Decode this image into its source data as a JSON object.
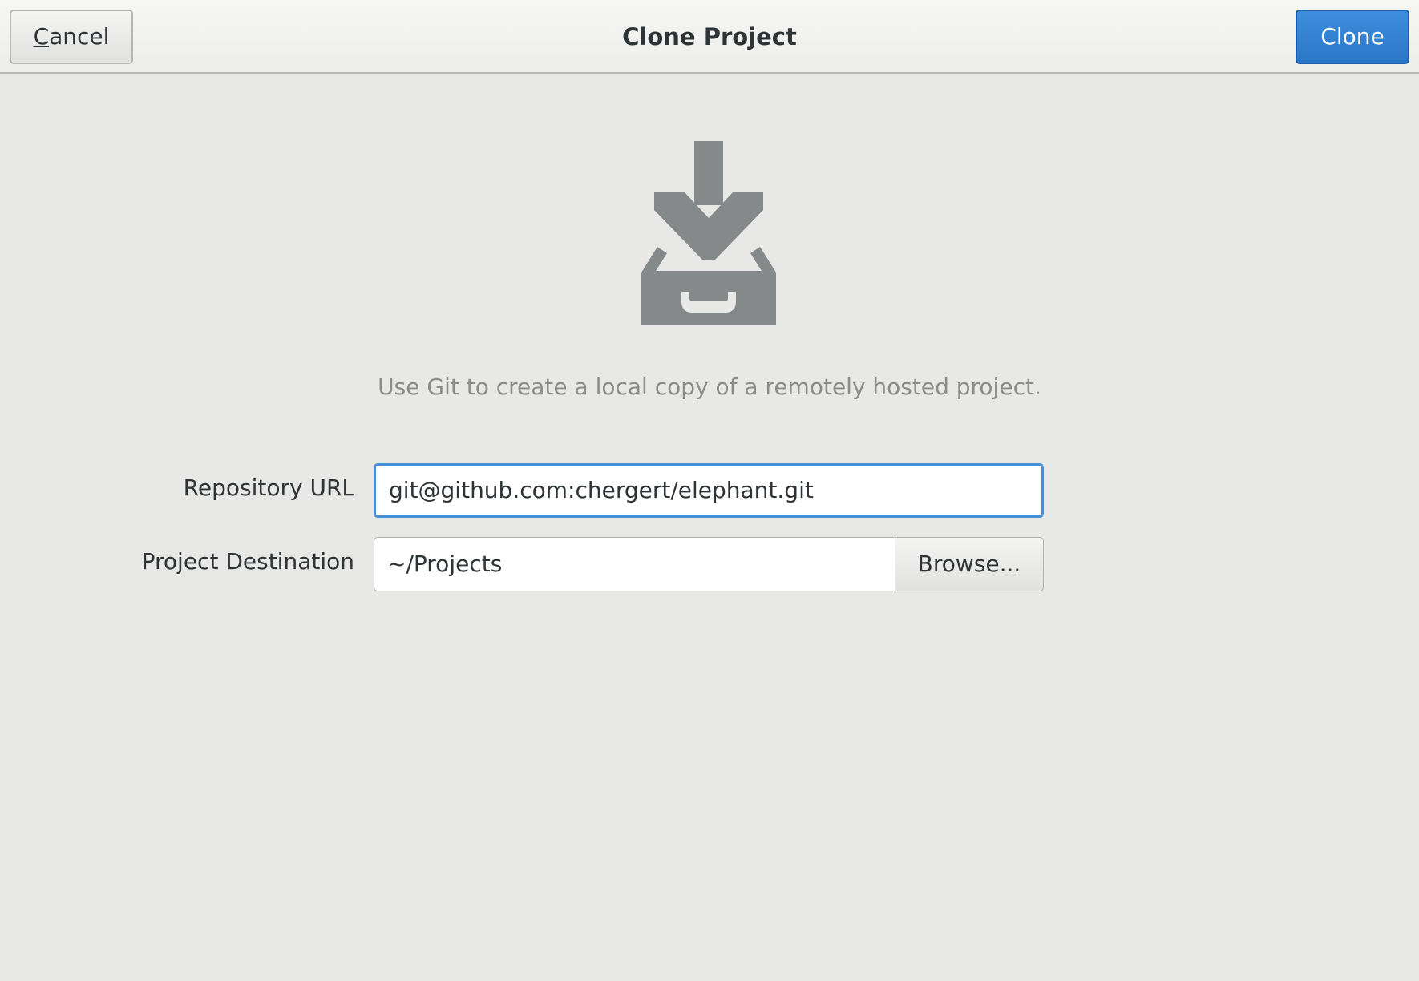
{
  "header": {
    "title": "Clone Project",
    "cancel_mnemonic": "C",
    "cancel_rest": "ancel",
    "clone_label": "Clone"
  },
  "main": {
    "icon": "folder-download-icon",
    "description": "Use Git to create a local copy of a remotely hosted project.",
    "repository": {
      "label": "Repository URL",
      "value": "git@github.com:chergert/elephant.git"
    },
    "destination": {
      "label": "Project Destination",
      "value": "~/Projects",
      "browse_label": "Browse..."
    }
  },
  "colors": {
    "accent": "#2a76c6",
    "focus": "#4a90d9",
    "icon": "#85898a",
    "background": "#e8e8e7"
  }
}
